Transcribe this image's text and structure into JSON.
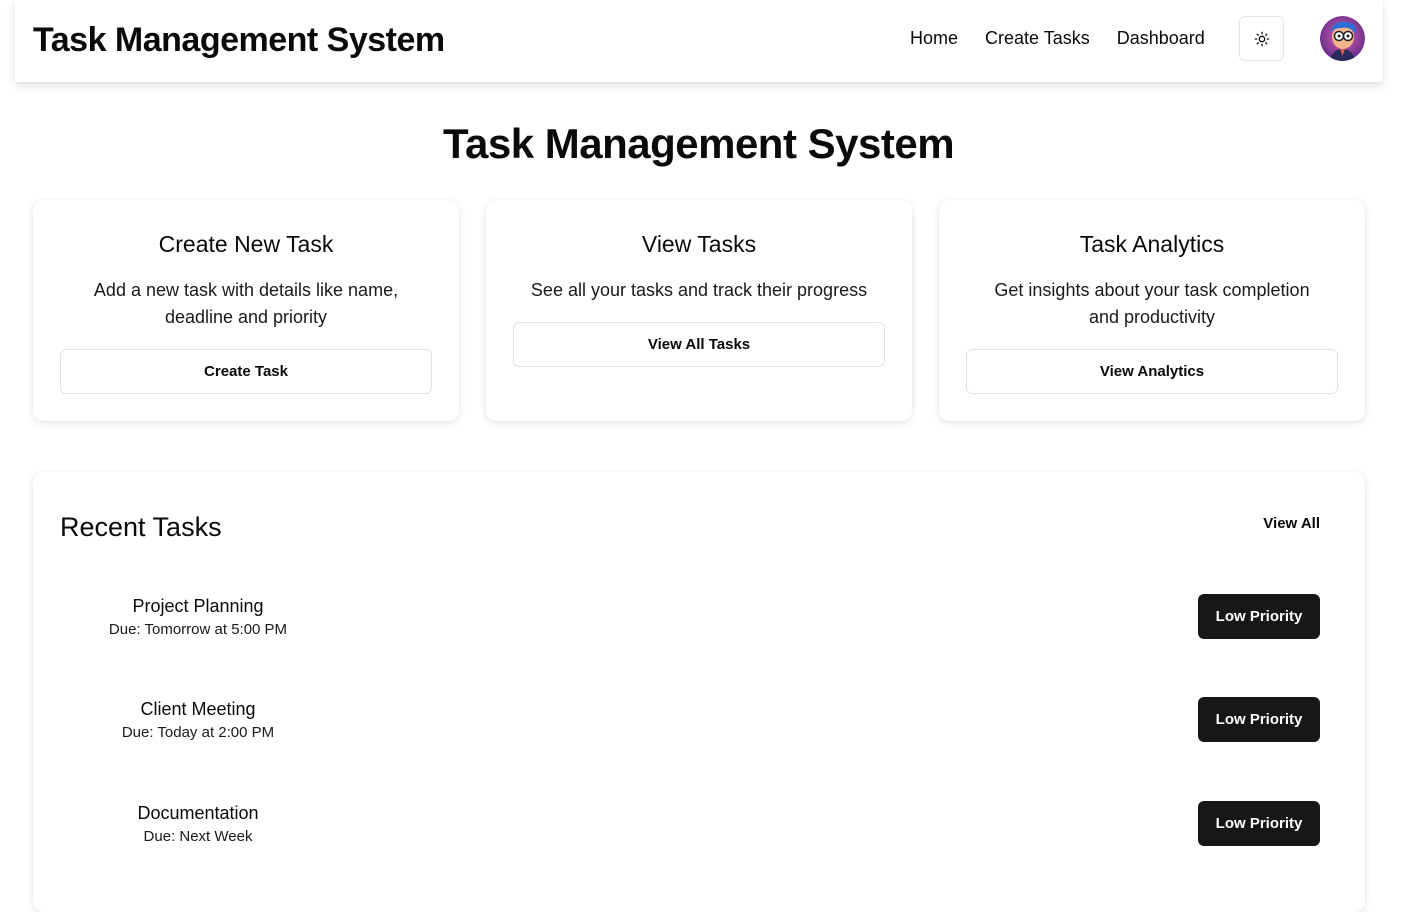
{
  "navbar": {
    "brand": "Task Management System",
    "links": [
      "Home",
      "Create Tasks",
      "Dashboard"
    ],
    "theme_icon": "sun-icon",
    "avatar_icon": "user-avatar"
  },
  "hero": {
    "title": "Task Management System"
  },
  "cards": [
    {
      "title": "Create New Task",
      "description": "Add a new task with details like name, deadline and priority",
      "button": "Create Task"
    },
    {
      "title": "View Tasks",
      "description": "See all your tasks and track their progress",
      "button": "View All Tasks"
    },
    {
      "title": "Task Analytics",
      "description": "Get insights about your task completion and productivity",
      "button": "View Analytics"
    }
  ],
  "recent": {
    "title": "Recent Tasks",
    "view_all": "View All",
    "tasks": [
      {
        "name": "Project Planning",
        "due": "Due: Tomorrow at 5:00 PM",
        "priority": "Low Priority"
      },
      {
        "name": "Client Meeting",
        "due": "Due: Today at 2:00 PM",
        "priority": "Low Priority"
      },
      {
        "name": "Documentation",
        "due": "Due: Next Week",
        "priority": "Low Priority"
      }
    ]
  },
  "colors": {
    "primary": "#171717",
    "border": "#e2e2e2",
    "background": "#ffffff"
  }
}
